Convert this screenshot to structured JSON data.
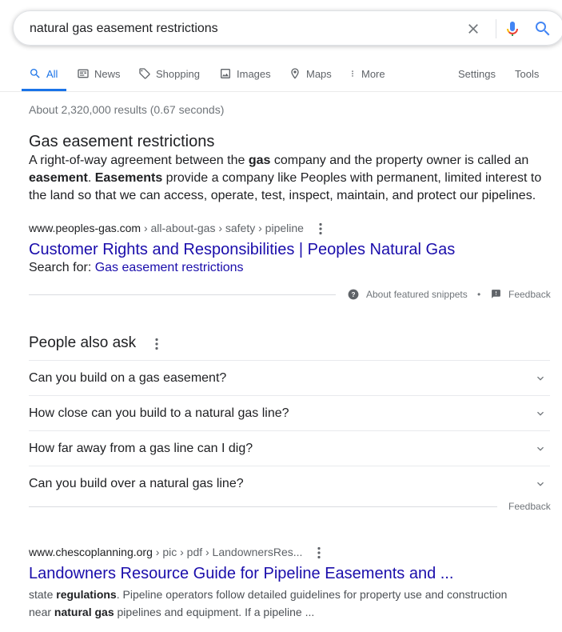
{
  "search": {
    "query": "natural gas easement restrictions"
  },
  "tabs": [
    {
      "label": "All",
      "icon": "search-icon"
    },
    {
      "label": "News",
      "icon": "news-icon"
    },
    {
      "label": "Shopping",
      "icon": "tag-icon"
    },
    {
      "label": "Images",
      "icon": "image-icon"
    },
    {
      "label": "Maps",
      "icon": "map-pin-icon"
    },
    {
      "label": "More",
      "icon": "more-vert-icon"
    }
  ],
  "tools": {
    "settings": "Settings",
    "tools": "Tools"
  },
  "stats": "About 2,320,000 results (0.67 seconds)",
  "featured": {
    "title": "Gas easement restrictions",
    "body": {
      "p1": "A right-of-way agreement between the ",
      "b1": "gas",
      "p2": " company and the property owner is called an ",
      "b2": "easement",
      "p3": ". ",
      "b3": "Easements",
      "p4": " provide a company like Peoples with permanent, limited interest to the land so that we can access, operate, test, inspect, maintain, and protect our pipelines."
    },
    "cite_domain": "www.peoples-gas.com",
    "cite_path": " › all-about-gas › safety › pipeline",
    "link_title": "Customer Rights and Responsibilities | Peoples Natural Gas",
    "search_for_label": "Search for: ",
    "search_for_link": "Gas easement restrictions",
    "about_snippets": "About featured snippets",
    "bullet": "•",
    "feedback": "Feedback"
  },
  "paa": {
    "title": "People also ask",
    "questions": [
      "Can you build on a gas easement?",
      "How close can you build to a natural gas line?",
      "How far away from a gas line can I dig?",
      "Can you build over a natural gas line?"
    ],
    "feedback": "Feedback"
  },
  "result2": {
    "cite_domain": "www.chescoplanning.org",
    "cite_path": " › pic › pdf › LandownersRes...",
    "title": "Landowners Resource Guide for Pipeline Easements and ...",
    "d1": "state ",
    "b1": "regulations",
    "d2": ". Pipeline operators follow detailed guidelines for property use and construction",
    "d3": "near ",
    "b2": "natural gas",
    "d4": " pipelines and equipment. If a pipeline ..."
  },
  "colors": {
    "accent": "#1a73e8",
    "link": "#1a0dab",
    "mic_red": "#ea4335"
  }
}
